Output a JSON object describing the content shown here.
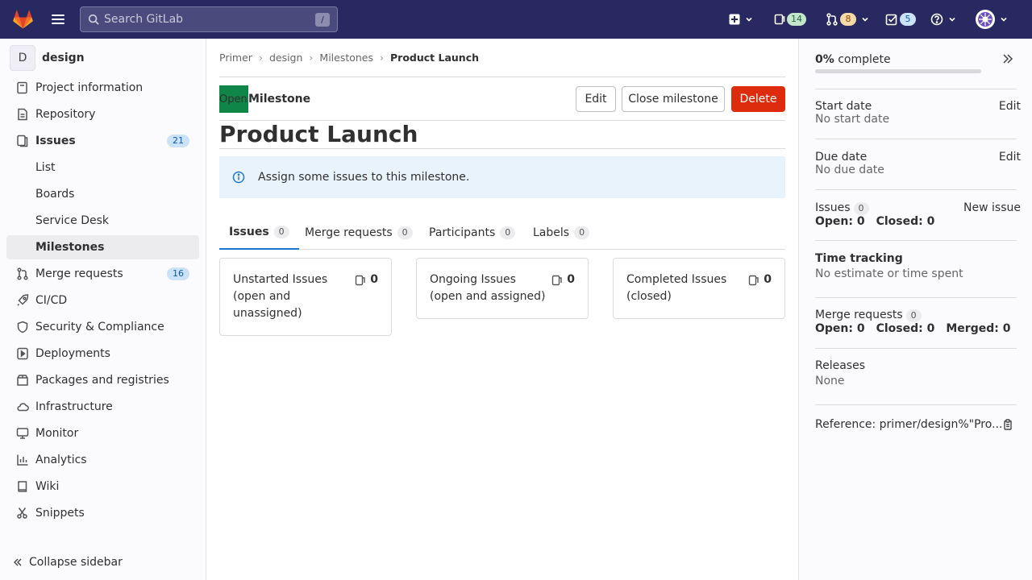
{
  "topbar": {
    "search_placeholder": "Search GitLab",
    "search_shortcut": "/",
    "issues_count": "14",
    "merge_requests_count": "8",
    "todos_count": "5"
  },
  "sidebar": {
    "project_initial": "D",
    "project_name": "design",
    "items": [
      {
        "label": "Project information"
      },
      {
        "label": "Repository"
      },
      {
        "label": "Issues",
        "badge": "21"
      },
      {
        "label": "List"
      },
      {
        "label": "Boards"
      },
      {
        "label": "Service Desk"
      },
      {
        "label": "Milestones"
      },
      {
        "label": "Merge requests",
        "badge": "16"
      },
      {
        "label": "CI/CD"
      },
      {
        "label": "Security & Compliance"
      },
      {
        "label": "Deployments"
      },
      {
        "label": "Packages and registries"
      },
      {
        "label": "Infrastructure"
      },
      {
        "label": "Monitor"
      },
      {
        "label": "Analytics"
      },
      {
        "label": "Wiki"
      },
      {
        "label": "Snippets"
      }
    ],
    "collapse_label": "Collapse sidebar"
  },
  "breadcrumb": [
    "Primer",
    "design",
    "Milestones",
    "Product Launch"
  ],
  "milestone": {
    "status_badge": "Open",
    "status_label": "Milestone",
    "edit_label": "Edit",
    "close_label": "Close milestone",
    "delete_label": "Delete",
    "title": "Product Launch",
    "alert": "Assign some issues to this milestone."
  },
  "tabs": [
    {
      "label": "Issues",
      "count": "0"
    },
    {
      "label": "Merge requests",
      "count": "0"
    },
    {
      "label": "Participants",
      "count": "0"
    },
    {
      "label": "Labels",
      "count": "0"
    }
  ],
  "cards": [
    {
      "title": "Unstarted Issues (open and unassigned)",
      "count": "0"
    },
    {
      "title": "Ongoing Issues (open and assigned)",
      "count": "0"
    },
    {
      "title": "Completed Issues (closed)",
      "count": "0"
    }
  ],
  "right_sidebar": {
    "complete_pct": "0%",
    "complete_label": "complete",
    "progress_fraction": 0,
    "start_date_label": "Start date",
    "start_date_value": "No start date",
    "due_date_label": "Due date",
    "due_date_value": "No due date",
    "edit_label": "Edit",
    "issues_label": "Issues",
    "issues_count": "0",
    "new_issue_label": "New issue",
    "issues_open": "Open: 0",
    "issues_closed": "Closed: 0",
    "time_tracking_label": "Time tracking",
    "time_tracking_value": "No estimate or time spent",
    "mr_label": "Merge requests",
    "mr_count": "0",
    "mr_open": "Open: 0",
    "mr_closed": "Closed: 0",
    "mr_merged": "Merged: 0",
    "releases_label": "Releases",
    "releases_value": "None",
    "reference": "Reference: primer/design%\"Pro..."
  }
}
